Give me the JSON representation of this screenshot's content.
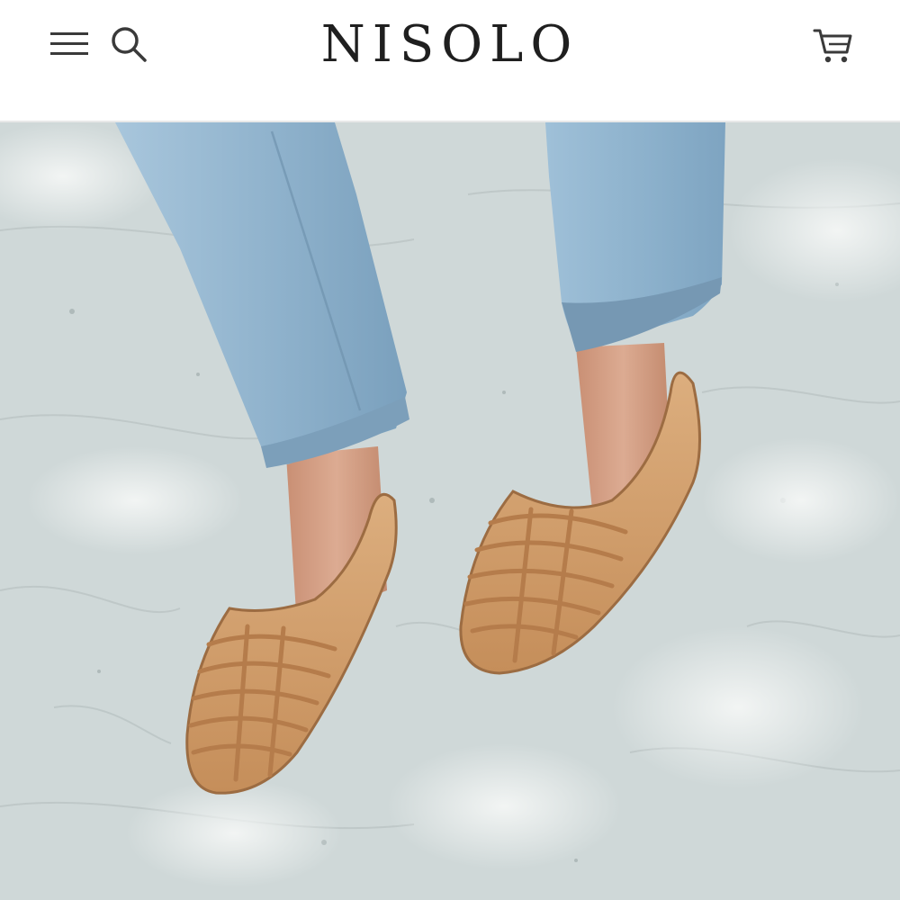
{
  "header": {
    "brand": "NISOLO",
    "icons": {
      "menu": "hamburger-menu-icon",
      "search": "search-icon",
      "cart": "shopping-cart-icon"
    }
  },
  "hero": {
    "image": "product-photo-woven-leather-flats",
    "colors": {
      "ground": "#cfd8d8",
      "denim": "#8fb2cc",
      "leather": "#d4a06c",
      "skin": "#d9a88e"
    }
  }
}
